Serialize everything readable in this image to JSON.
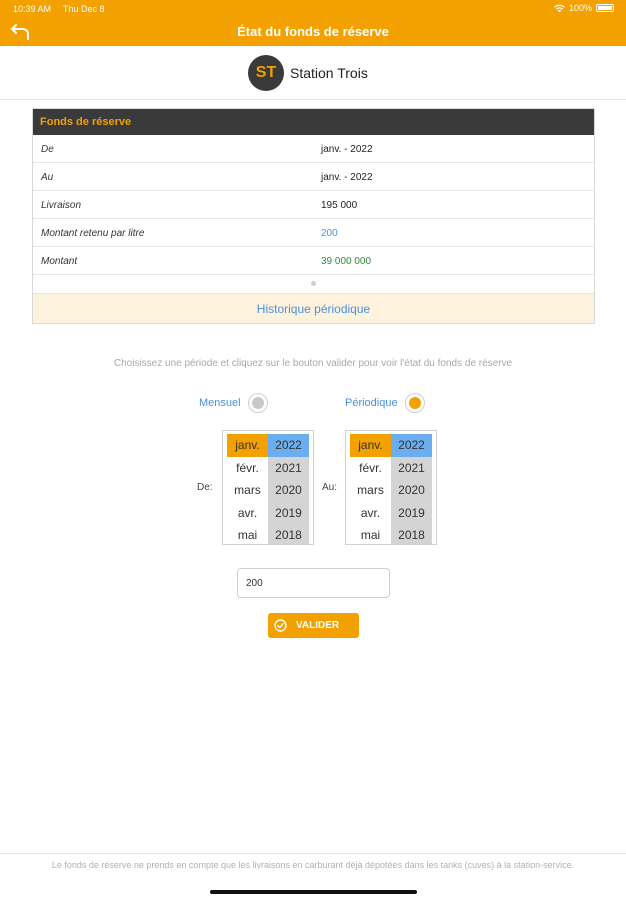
{
  "status": {
    "time": "10:39 AM",
    "date": "Thu Dec 8",
    "battery": "100%"
  },
  "nav": {
    "title": "État du fonds de réserve"
  },
  "brand": {
    "initials": "ST",
    "name": "Station Trois"
  },
  "reserve": {
    "header": "Fonds de réserve",
    "rows": [
      {
        "label": "De",
        "value": "janv. -  2022"
      },
      {
        "label": "Au",
        "value": "janv. -  2022"
      },
      {
        "label": "Livraison",
        "value": "195 000"
      },
      {
        "label": "Montant retenu par litre",
        "value": "200"
      },
      {
        "label": "Montant",
        "value": "39 000 000"
      }
    ],
    "history_label": "Historique périodique"
  },
  "hint": "Choisissez une période et cliquez sur le bouton valider pour voir l'état du fonds de réserve",
  "options": {
    "monthly": "Mensuel",
    "periodic": "Périodique",
    "selected": "periodic"
  },
  "pickers": {
    "from_label": "De:",
    "to_label": "Au:",
    "months": [
      "janv.",
      "févr.",
      "mars",
      "avr.",
      "mai"
    ],
    "years": [
      "2022",
      "2021",
      "2020",
      "2019",
      "2018"
    ]
  },
  "amount_value": "200",
  "validate_label": "VALIDER",
  "footer": "Le fonds de réserve ne prends en compte que les livraisons en carburant déjà dépotées dans les tanks (cuves) à la station-service.",
  "colors": {
    "accent": "#f2a100",
    "header_dark": "#3a3a3a",
    "link_blue": "#4a90e2",
    "amount_green": "#2e8b3a"
  }
}
